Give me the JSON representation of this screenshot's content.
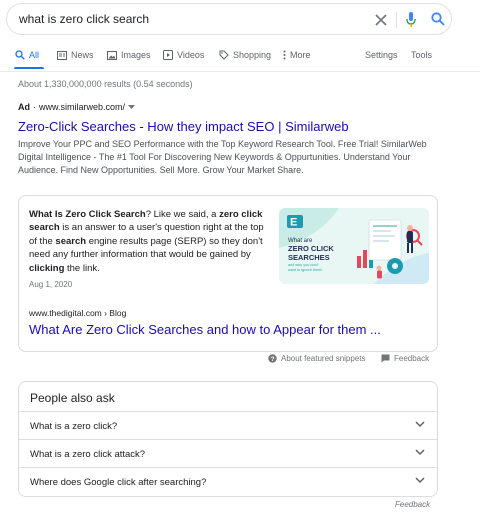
{
  "search": {
    "query": "what is zero click search",
    "clear_icon": "close-icon",
    "mic_icon": "mic-icon",
    "search_icon": "search-icon"
  },
  "tabs": [
    {
      "label": "All",
      "icon": "search-icon",
      "active": true
    },
    {
      "label": "News",
      "icon": "news-icon"
    },
    {
      "label": "Images",
      "icon": "image-icon"
    },
    {
      "label": "Videos",
      "icon": "video-icon"
    },
    {
      "label": "Shopping",
      "icon": "tag-icon"
    },
    {
      "label": "More",
      "icon": "more-vert-icon"
    }
  ],
  "tools": {
    "settings": "Settings",
    "tools": "Tools"
  },
  "stats": "About 1,330,000,000 results (0.54 seconds)",
  "ad": {
    "badge": "Ad",
    "url": "www.similarweb.com/",
    "title": "Zero-Click Searches - How they impact SEO | Similarweb",
    "description": "Improve Your PPC and SEO Performance with the Top Keyword Research Tool. Free Trial! SimilarWeb Digital Intelligence - The #1 Tool For Discovering New Keywords & Oppurtunities. Understand Your Audience. Find New Opportunities. Sell More. Grow Your Market Share."
  },
  "snippet": {
    "parts": [
      {
        "t": "What Is Zero Click Search",
        "b": true
      },
      {
        "t": "? Like we said, a ",
        "b": false
      },
      {
        "t": "zero click search",
        "b": true
      },
      {
        "t": " is an answer to a user's question right at the top of the ",
        "b": false
      },
      {
        "t": "search",
        "b": true
      },
      {
        "t": " engine results page (SERP) so they don't need any further information that would be gained by ",
        "b": false
      },
      {
        "t": "clicking",
        "b": true
      },
      {
        "t": " the link.",
        "b": false
      }
    ],
    "date": "Aug 1, 2020",
    "image": {
      "line1": "What are",
      "line2": "ZERO CLICK",
      "line3": "SEARCHES",
      "line4": "and why you don't",
      "line5": "want to ignore them!",
      "accent": "#2aa8a0",
      "logo": "E"
    },
    "cite": "www.thedigital.com › Blog",
    "link": "What Are Zero Click Searches and how to Appear for them ..."
  },
  "snippet_footer": {
    "about": "About featured snippets",
    "feedback": "Feedback"
  },
  "paa": {
    "title": "People also ask",
    "questions": [
      "What is a zero click?",
      "What is a zero click attack?",
      "Where does Google click after searching?"
    ]
  },
  "bottom_feedback": "Feedback",
  "colors": {
    "link": "#1a0dab",
    "accent": "#1a73e8",
    "muted": "#70757a"
  }
}
